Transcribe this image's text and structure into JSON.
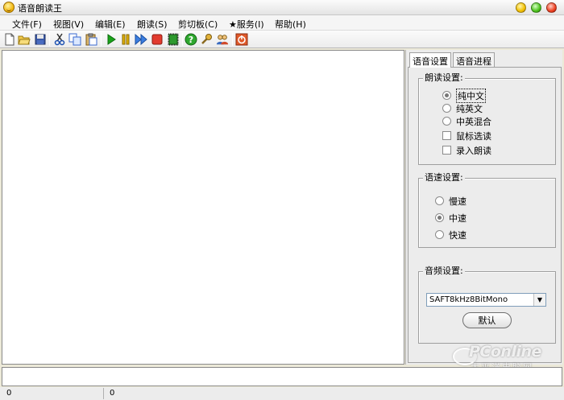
{
  "window": {
    "title": "语音朗读王"
  },
  "menu": [
    "文件(F)",
    "视图(V)",
    "编辑(E)",
    "朗读(S)",
    "剪切板(C)",
    "★服务(I)",
    "帮助(H)"
  ],
  "toolbar": {
    "icons": [
      "new-file-icon",
      "open-folder-icon",
      "save-icon",
      "cut-icon",
      "copy-icon",
      "paste-icon",
      "play-icon",
      "pause-icon",
      "fast-forward-icon",
      "stop-icon",
      "record-icon",
      "help-icon",
      "settings-icon",
      "users-icon",
      "power-icon"
    ]
  },
  "panel": {
    "tabs": [
      "语音设置",
      "语音进程"
    ],
    "read_group": {
      "label": "朗读设置:",
      "options": [
        {
          "label": "纯中文",
          "type": "radio",
          "checked": true
        },
        {
          "label": "纯英文",
          "type": "radio",
          "checked": false
        },
        {
          "label": "中英混合",
          "type": "radio",
          "checked": false
        },
        {
          "label": "鼠标选读",
          "type": "checkbox",
          "checked": false
        },
        {
          "label": "录入朗读",
          "type": "checkbox",
          "checked": false
        }
      ]
    },
    "speed_group": {
      "label": "语速设置:",
      "options": [
        {
          "label": "慢速",
          "checked": false
        },
        {
          "label": "中速",
          "checked": true
        },
        {
          "label": "快速",
          "checked": false
        }
      ]
    },
    "audio_group": {
      "label": "音频设置:",
      "format_value": "SAFT8kHz8BitMono",
      "default_button": "默认"
    }
  },
  "watermark": {
    "brand": "PConline",
    "sub": "太平洋电脑网"
  },
  "status": {
    "left_value": "0",
    "right_value": "0"
  }
}
